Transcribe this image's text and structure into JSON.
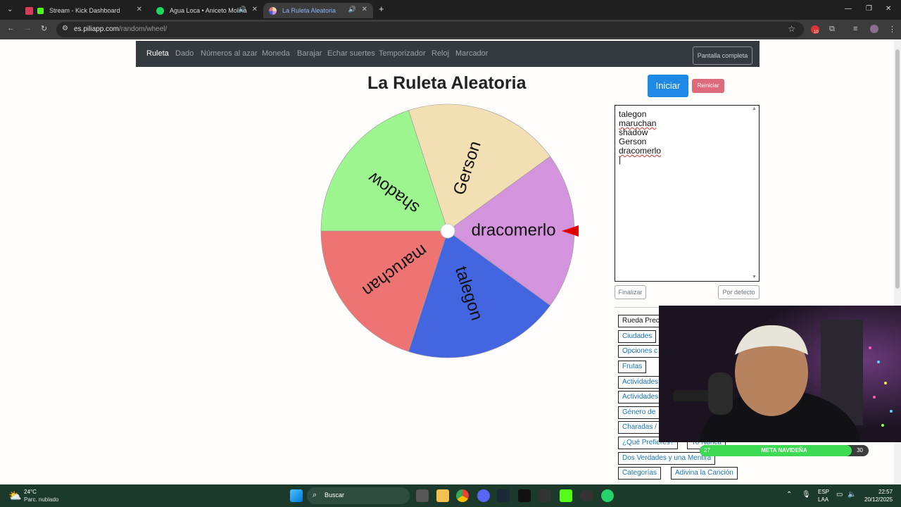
{
  "browser": {
    "tabs": [
      {
        "title": "Stream - Kick Dashboard",
        "active": false
      },
      {
        "title": "Agua Loca • Aniceto Molina",
        "active": false
      },
      {
        "title": "La Ruleta Aleatoria",
        "active": true
      }
    ],
    "new_tab": "+",
    "url_host": "es.piliapp.com",
    "url_path": "/random/wheel/",
    "notif_badge": "10"
  },
  "site_nav": {
    "items": [
      "Ruleta",
      "Dado",
      "Números al azar",
      "Moneda",
      "Barajar",
      "Echar suertes",
      "Temporizador",
      "Reloj",
      "Marcador"
    ],
    "fullscreen": "Pantalla completa"
  },
  "page": {
    "title": "La Ruleta Aleatoria",
    "start": "Iniciar",
    "reset": "Reiniciar",
    "entries": [
      "talegon",
      "maruchan",
      "shadow",
      "Gerson",
      "dracomerlo"
    ],
    "finish": "Finalizar",
    "default": "Por defecto"
  },
  "wheel": {
    "segments": [
      {
        "label": "Gerson",
        "color": "#f3dfb4"
      },
      {
        "label": "dracomerlo",
        "color": "#d494dd"
      },
      {
        "label": "talegon",
        "color": "#4465e0"
      },
      {
        "label": "maruchan",
        "color": "#ee7474"
      },
      {
        "label": "shadow",
        "color": "#9cf58f"
      }
    ],
    "pointer_color": "#e00000"
  },
  "presets": [
    {
      "label": "Rueda Prec",
      "dark": true
    },
    {
      "label": "Ciudades"
    },
    {
      "label": "Opciones c"
    },
    {
      "label": "Frutas"
    },
    {
      "label": "Actividades"
    },
    {
      "label": "Actividades"
    },
    {
      "label": "Género de"
    },
    {
      "label": "Charadas /"
    },
    {
      "label": "¿Qué Prefieres?"
    },
    {
      "label": "Yo Nunca"
    },
    {
      "label": "Dos Verdades y una Mentira"
    },
    {
      "label": "Categorías"
    },
    {
      "label": "Adivina la Canción"
    }
  ],
  "overlay": {
    "meta_label": "META NAVIDEÑA",
    "meta_current": "27",
    "meta_goal": "30",
    "meta_progress": 0.9
  },
  "taskbar": {
    "temp": "24°C",
    "weather": "Parc. nublado",
    "search": "Buscar",
    "lang_top": "ESP",
    "lang_bottom": "LAA",
    "time": "22:57",
    "date": "20/12/2025"
  }
}
